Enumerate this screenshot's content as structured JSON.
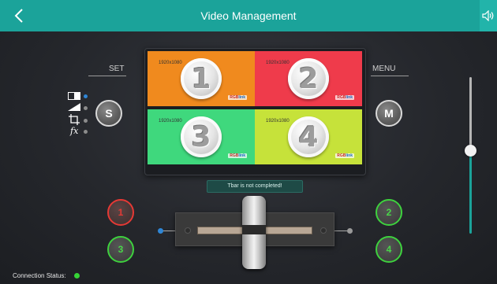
{
  "header": {
    "title": "Video Management",
    "back_icon": "chevron-left-icon",
    "speaker_icon": "speaker-icon"
  },
  "set_panel": {
    "label": "SET",
    "button_label": "S",
    "options": [
      {
        "icon": "layout-icon",
        "active": true
      },
      {
        "icon": "ramp-icon",
        "active": false
      },
      {
        "icon": "crop-icon",
        "active": false
      },
      {
        "icon": "fx-icon",
        "label": "fx",
        "active": false
      }
    ]
  },
  "menu_panel": {
    "label": "MENU",
    "button_label": "M"
  },
  "preview": {
    "quadrants": [
      {
        "number": "1",
        "resolution": "1920x1080",
        "color": "#f08a1e"
      },
      {
        "number": "2",
        "resolution": "1920x1080",
        "color": "#ef3b4b"
      },
      {
        "number": "3",
        "resolution": "1920x1080",
        "color": "#3fd87d"
      },
      {
        "number": "4",
        "resolution": "1920x1080",
        "color": "#c6e23a"
      }
    ]
  },
  "status_message": "Tbar is not completed!",
  "source_buttons": {
    "left": [
      {
        "label": "1",
        "state": "selected-red"
      },
      {
        "label": "3",
        "state": "green"
      }
    ],
    "right": [
      {
        "label": "2",
        "state": "green"
      },
      {
        "label": "4",
        "state": "green"
      }
    ]
  },
  "tbar": {
    "position": "center"
  },
  "volume_slider": {
    "level": 0.49
  },
  "connection": {
    "label": "Connection Status:",
    "connected": true
  },
  "colors": {
    "accent": "#1ba39a",
    "red": "#e53935",
    "green": "#3ed13e",
    "blue": "#2f86d6"
  }
}
